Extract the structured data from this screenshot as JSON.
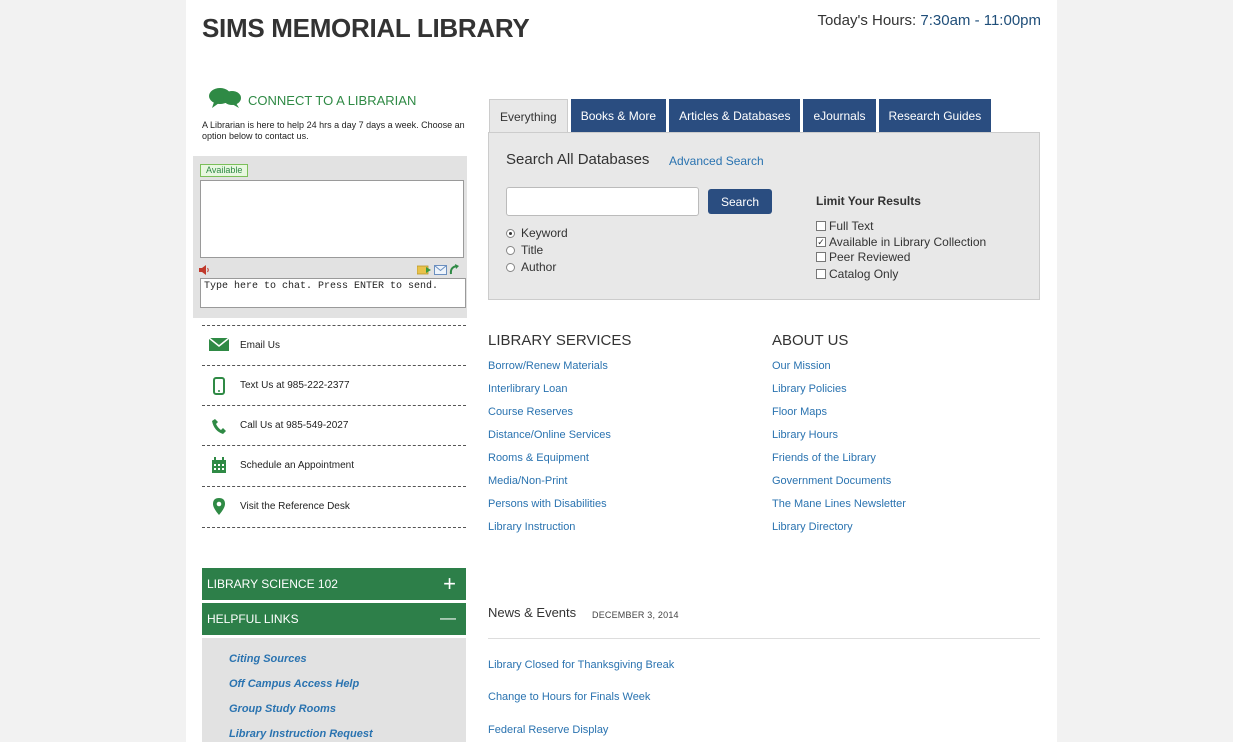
{
  "header": {
    "title": "SIMS MEMORIAL LIBRARY",
    "hours_label": "Today's Hours:",
    "hours_value": "7:30am - 11:00pm"
  },
  "connect": {
    "heading": "CONNECT TO A LIBRARIAN",
    "subtext": "A Librarian is here to help 24 hrs a day 7 days a week. Choose an option below to contact us.",
    "status": "Available",
    "chat_placeholder": "Type here to chat. Press ENTER to send."
  },
  "contacts": [
    {
      "label": "Email Us",
      "icon": "email-icon"
    },
    {
      "label": "Text Us at 985-222-2377",
      "icon": "phone-icon"
    },
    {
      "label": "Call Us at 985-549-2027",
      "icon": "call-icon"
    },
    {
      "label": "Schedule an Appointment",
      "icon": "calendar-icon"
    },
    {
      "label": "Visit the Reference Desk",
      "icon": "location-icon"
    }
  ],
  "accordion": [
    {
      "label": "LIBRARY SCIENCE 102",
      "symbol": "+"
    },
    {
      "label": "HELPFUL LINKS",
      "symbol": "—"
    }
  ],
  "helpful_links": [
    "Citing Sources",
    "Off Campus Access Help",
    "Group Study Rooms",
    "Library Instruction Request"
  ],
  "search": {
    "tabs": [
      "Everything",
      "Books & More",
      "Articles & Databases",
      "eJournals",
      "Research Guides"
    ],
    "active_tab": "Everything",
    "title": "Search All Databases",
    "advanced": "Advanced Search",
    "button": "Search",
    "radios": [
      "Keyword",
      "Title",
      "Author"
    ],
    "selected_radio": "Keyword",
    "limit_heading": "Limit Your Results",
    "checkboxes": [
      {
        "label": "Full Text",
        "checked": false
      },
      {
        "label": "Available in Library Collection",
        "checked": true
      },
      {
        "label": "Peer Reviewed",
        "checked": false
      },
      {
        "label": "Catalog Only",
        "checked": false
      }
    ]
  },
  "library_services": {
    "heading": "LIBRARY SERVICES",
    "links": [
      "Borrow/Renew Materials",
      "Interlibrary Loan",
      "Course Reserves",
      "Distance/Online Services",
      "Rooms & Equipment",
      "Media/Non-Print",
      "Persons with Disabilities",
      "Library Instruction"
    ]
  },
  "about_us": {
    "heading": "ABOUT US",
    "links": [
      "Our Mission",
      "Library Policies",
      "Floor Maps",
      "Library Hours",
      "Friends of the Library",
      "Government Documents",
      "The Mane Lines Newsletter",
      "Library Directory"
    ]
  },
  "news": {
    "heading": "News & Events",
    "date": "DECEMBER 3, 2014",
    "items": [
      "Library Closed for Thanksgiving Break",
      "Change to Hours for Finals Week",
      "Federal Reserve Display"
    ]
  },
  "colors": {
    "green": "#2d7f49",
    "navy": "#2a4d80",
    "link": "#2a73b0"
  }
}
